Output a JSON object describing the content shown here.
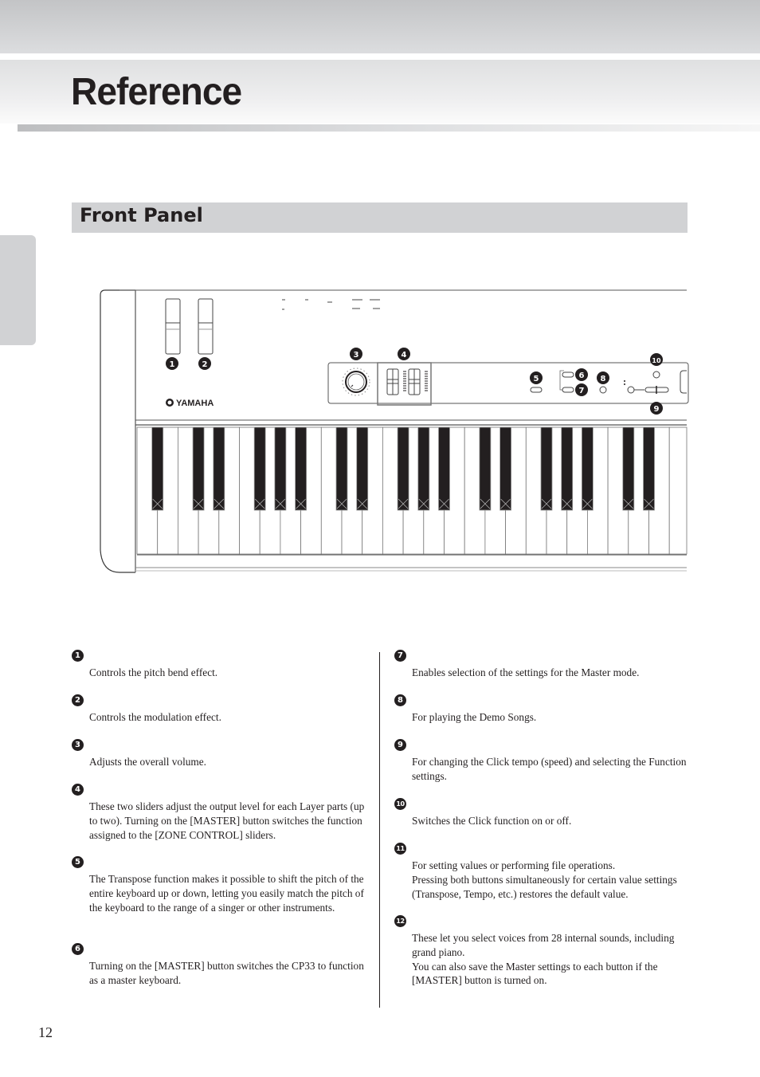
{
  "header": {
    "title": "Reference"
  },
  "section": {
    "title": "Front Panel"
  },
  "illustration": {
    "brand_logo": "YAMAHA",
    "callouts": [
      "1",
      "2",
      "3",
      "4",
      "5",
      "6",
      "7",
      "8",
      "9",
      "10"
    ]
  },
  "items": [
    {
      "number": "1",
      "description": "Controls the pitch bend effect."
    },
    {
      "number": "2",
      "description": "Controls the modulation effect."
    },
    {
      "number": "3",
      "description": "Adjusts the overall volume."
    },
    {
      "number": "4",
      "description": "These two sliders adjust the output level for each Layer parts (up to two). Turning on the [MASTER] button switches the function assigned to the [ZONE CONTROL] sliders."
    },
    {
      "number": "5",
      "description": "The Transpose function makes it possible to shift the pitch of the entire keyboard up or down, letting you easily match the pitch of the keyboard to the range of a singer or other instruments."
    },
    {
      "number": "6",
      "description": "Turning on the [MASTER] button switches the CP33 to function as a master keyboard."
    },
    {
      "number": "7",
      "description": "Enables selection of the settings for the Master mode."
    },
    {
      "number": "8",
      "description": "For playing the Demo Songs."
    },
    {
      "number": "9",
      "description": "For changing the Click tempo (speed) and selecting the Function settings."
    },
    {
      "number": "10",
      "description": "Switches the Click function on or off."
    },
    {
      "number": "11",
      "description": "For setting values or performing file operations.\nPressing both buttons simultaneously for certain value settings (Transpose, Tempo, etc.) restores the default value."
    },
    {
      "number": "12",
      "description": "These let you select voices from 28 internal sounds, including grand piano.\nYou can also save the Master settings to each button if the [MASTER] button is turned on."
    }
  ],
  "footer": {
    "page_number": "12"
  },
  "colors": {
    "text": "#231f20",
    "band_gray": "#d1d2d4"
  }
}
